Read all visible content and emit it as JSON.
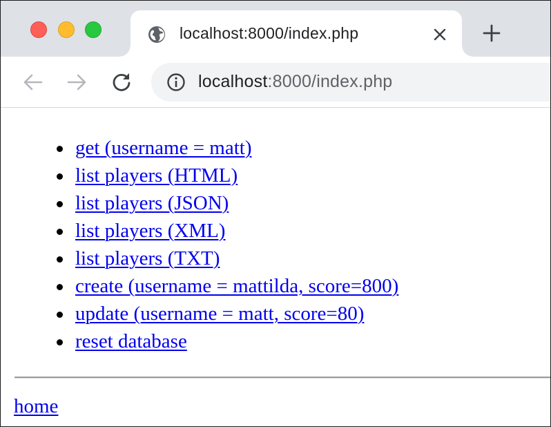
{
  "browser": {
    "tab": {
      "title": "localhost:8000/index.php",
      "icon": "globe-icon"
    },
    "toolbar": {
      "url_host": "localhost",
      "url_rest": ":8000/index.php"
    },
    "colors": {
      "close": "#fe5f57",
      "minimize": "#febc2e",
      "maximize": "#28c840",
      "link": "#0000ee"
    }
  },
  "page": {
    "links": [
      "get (username = matt)",
      "list players (HTML)",
      "list players (JSON)",
      "list players (XML)",
      "list players (TXT)",
      "create (username = mattilda, score=800)",
      "update (username = matt, score=80)",
      "reset database"
    ],
    "home_link": "home"
  }
}
